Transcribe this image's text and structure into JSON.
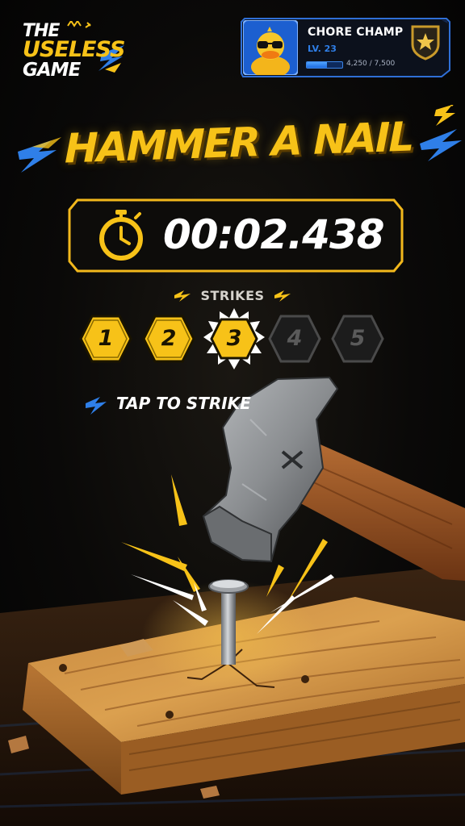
{
  "logo": {
    "line1": "THE",
    "line2": "USELESS",
    "line3": "GAME"
  },
  "player": {
    "name": "CHORE CHAMP",
    "level": "LV. 23",
    "xp_text": "4,250 / 7,500",
    "xp_fraction": 0.567
  },
  "title": "HAMMER A NAIL",
  "timer": {
    "value": "00:02.438"
  },
  "strikes": {
    "label": "STRIKES",
    "items": [
      {
        "number": "1",
        "state": "done"
      },
      {
        "number": "2",
        "state": "done"
      },
      {
        "number": "3",
        "state": "current"
      },
      {
        "number": "4",
        "state": "pending"
      },
      {
        "number": "5",
        "state": "pending"
      }
    ]
  },
  "prompt": "TAP TO STRIKE",
  "colors": {
    "accent": "#f7c218",
    "blue": "#2f7fe8",
    "pending": "#4a4a4a"
  },
  "icons": {
    "timer": "stopwatch-icon",
    "badge": "star-shield-icon"
  }
}
